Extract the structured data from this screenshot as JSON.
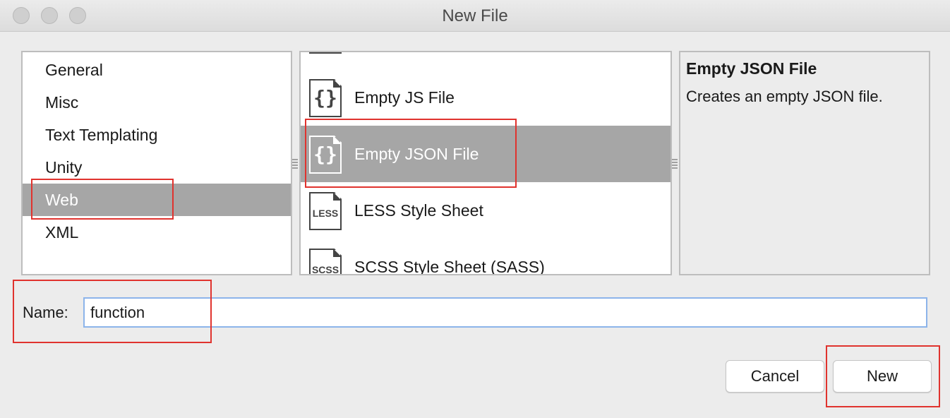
{
  "window": {
    "title": "New File"
  },
  "categories": {
    "items": [
      {
        "label": "General"
      },
      {
        "label": "Misc"
      },
      {
        "label": "Text Templating"
      },
      {
        "label": "Unity"
      },
      {
        "label": "Web",
        "selected": true
      },
      {
        "label": "XML"
      }
    ]
  },
  "templates": {
    "items": [
      {
        "label": "Empty JS File",
        "icon": "curly-braces-file-icon",
        "glyph": "{}"
      },
      {
        "label": "Empty JSON File",
        "icon": "curly-braces-file-icon",
        "glyph": "{}",
        "selected": true
      },
      {
        "label": "LESS Style Sheet",
        "icon": "less-file-icon",
        "glyph": "LESS"
      },
      {
        "label": "SCSS Style Sheet (SASS)",
        "icon": "scss-file-icon",
        "glyph": "SCSS"
      }
    ]
  },
  "description": {
    "title": "Empty JSON File",
    "text": "Creates an empty JSON file."
  },
  "name": {
    "label": "Name:",
    "value": "function"
  },
  "buttons": {
    "cancel": "Cancel",
    "new": "New"
  },
  "colors": {
    "selection": "#a6a6a6",
    "highlight": "#e0332e",
    "input_focus": "#8cb4ea"
  }
}
